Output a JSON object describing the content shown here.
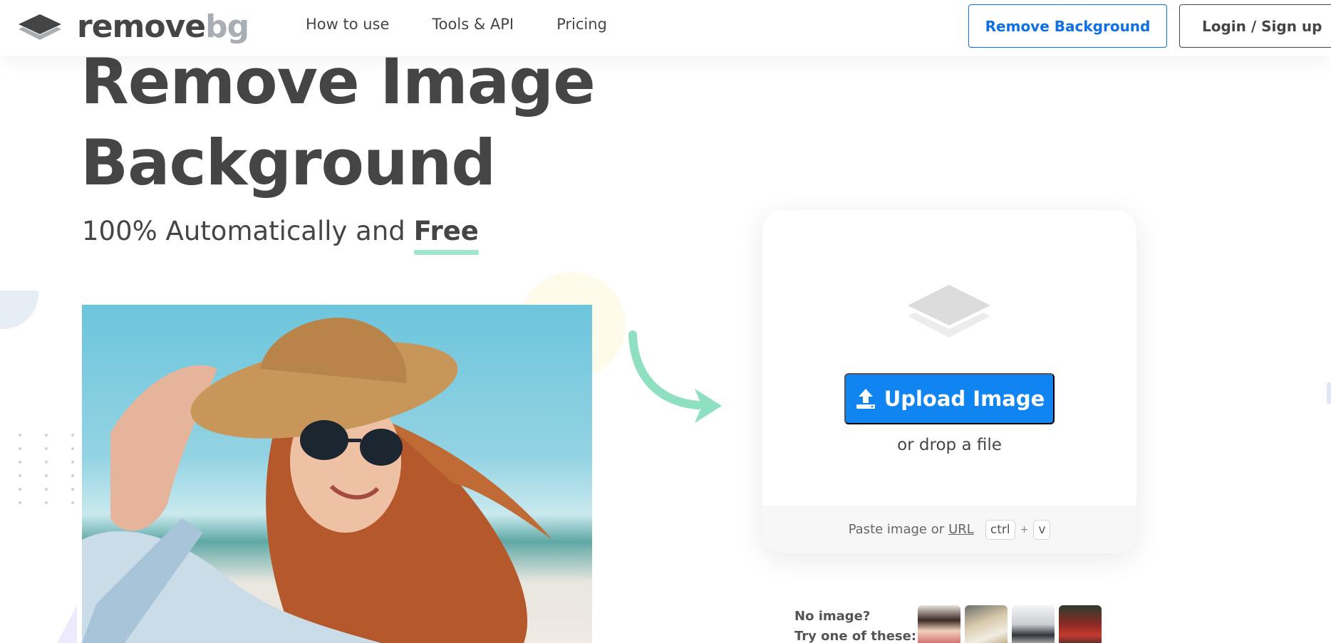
{
  "brand": {
    "logo_text_1": "remove",
    "logo_text_2": "bg",
    "logo_icon": "layers-logo-icon"
  },
  "nav": {
    "items": [
      {
        "label": "How to use"
      },
      {
        "label": "Tools & API"
      },
      {
        "label": "Pricing"
      }
    ]
  },
  "header_actions": {
    "remove_bg_label": "Remove Background",
    "login_label": "Login / Sign up"
  },
  "hero": {
    "title_line_1": "Remove Image",
    "title_line_2": "Background",
    "subtitle_prefix": "100% Automatically and ",
    "subtitle_emphasis": "Free"
  },
  "upload": {
    "button_label": "Upload Image",
    "button_icon": "upload-icon",
    "drop_text": "or drop a file",
    "paste_prefix": "Paste image or",
    "paste_url": "URL",
    "key_ctrl": "ctrl",
    "key_plus": "+",
    "key_v": "v"
  },
  "samples": {
    "line_1": "No image?",
    "line_2": "Try one of these:",
    "count": 4
  },
  "colors": {
    "accent_blue": "#1085f1",
    "text_dark": "#454545",
    "highlight_green": "#9fe5cf"
  }
}
